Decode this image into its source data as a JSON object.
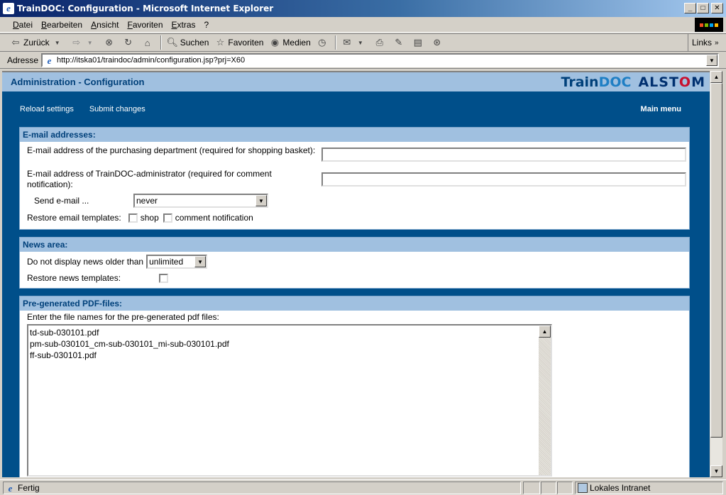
{
  "window": {
    "title": "TrainDOC: Configuration - Microsoft Internet Explorer",
    "min": "_",
    "max": "□",
    "close": "✕"
  },
  "menu": [
    "Datei",
    "Bearbeiten",
    "Ansicht",
    "Favoriten",
    "Extras",
    "?"
  ],
  "toolbar": {
    "back": "Zurück",
    "search": "Suchen",
    "favorites": "Favoriten",
    "media": "Medien",
    "links": "Links"
  },
  "address": {
    "label": "Adresse",
    "url": "http://itska01/traindoc/admin/configuration.jsp?prj=X60"
  },
  "page": {
    "title": "Administration - Configuration",
    "logo": {
      "part1": "Train",
      "part2": "DOC",
      "brand_a": "ALST",
      "brand_o": "O",
      "brand_b": "M"
    },
    "actions": {
      "reload": "Reload settings",
      "submit": "Submit changes",
      "main_menu": "Main menu"
    },
    "email": {
      "heading": "E-mail addresses:",
      "purchasing_label": "E-mail address of the purchasing department (required for shopping basket):",
      "purchasing_value": "",
      "admin_label": "E-mail address of TrainDOC-administrator (required for comment notification):",
      "admin_value": "",
      "send_label": "Send e-mail ...",
      "send_value": "never",
      "restore_label": "Restore email templates:",
      "shop_label": "shop",
      "comment_label": "comment notification"
    },
    "news": {
      "heading": "News area:",
      "older_label": "Do not display news older than",
      "older_value": "unlimited",
      "restore_label": "Restore news templates:"
    },
    "pdf": {
      "heading": "Pre-generated PDF-files:",
      "instruction": "Enter the file names for the pre-generated pdf files:",
      "files": [
        "td-sub-030101.pdf",
        "pm-sub-030101_cm-sub-030101_mi-sub-030101.pdf",
        "ff-sub-030101.pdf"
      ]
    }
  },
  "status": {
    "text": "Fertig",
    "zone": "Lokales Intranet"
  }
}
